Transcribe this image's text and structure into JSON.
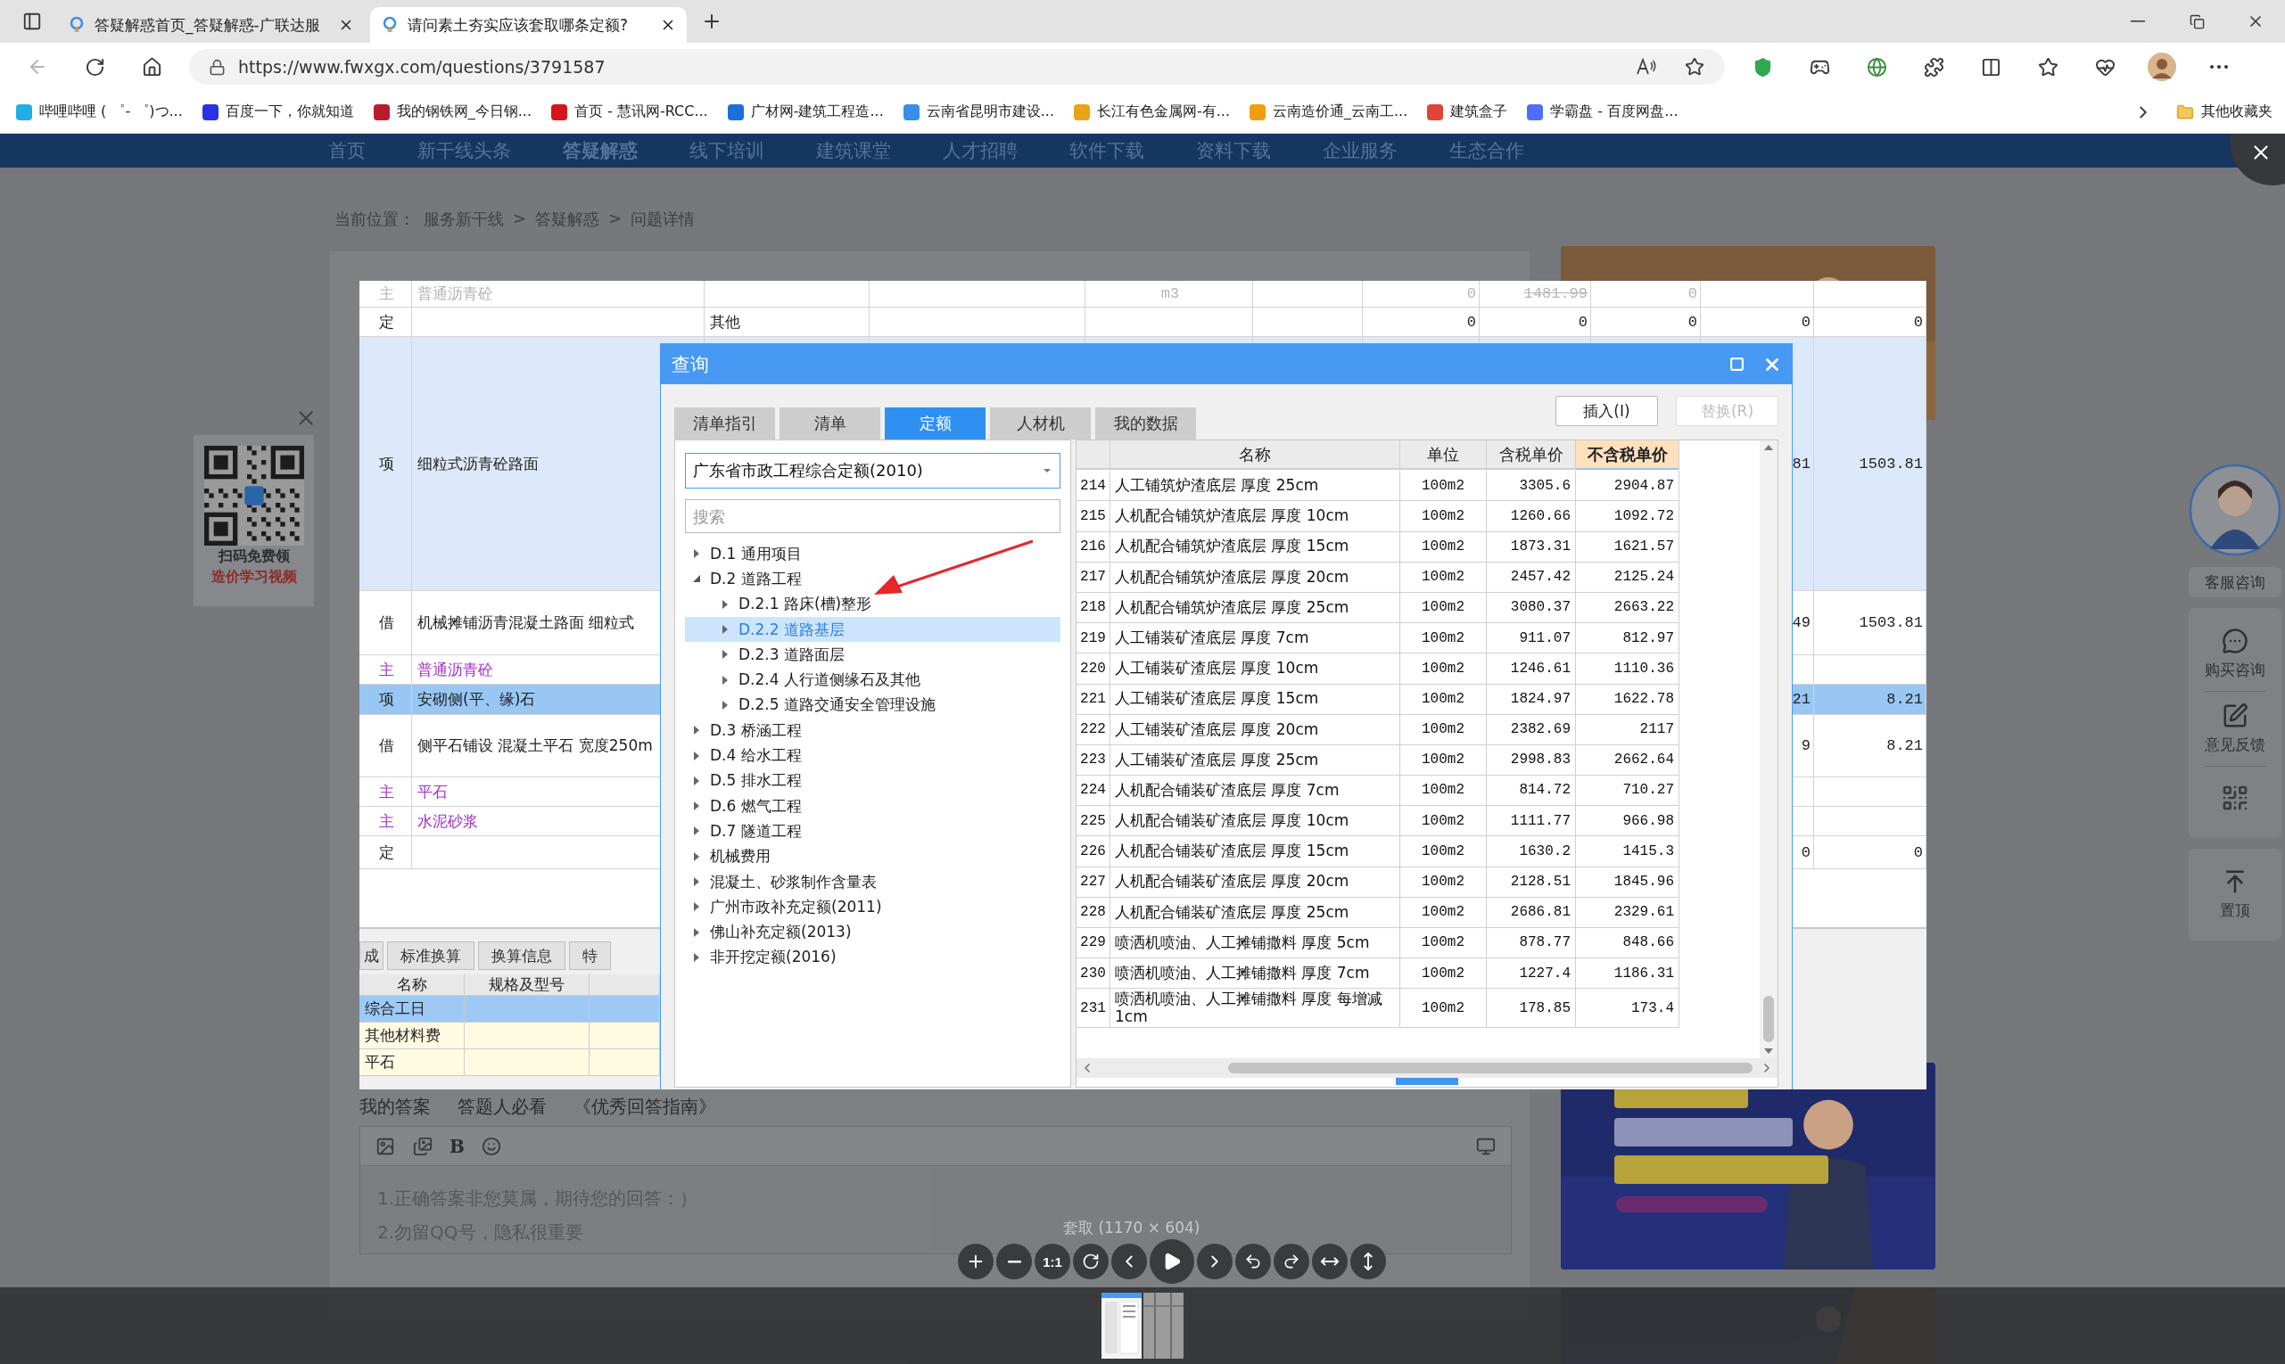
{
  "browser": {
    "tabs": [
      {
        "title": "答疑解惑首页_答疑解惑-广联达服",
        "selected": false
      },
      {
        "title": "请问素土夯实应该套取哪条定额?",
        "selected": true
      }
    ],
    "url": "https://www.fwxgx.com/questions/3791587",
    "bookmarks": [
      {
        "label": "哔哩哔哩 ( ゜- ゜)つ...",
        "color": "#23ade5"
      },
      {
        "label": "百度一下，你就知道",
        "color": "#2932e1"
      },
      {
        "label": "我的钢铁网_今日钢...",
        "color": "#b81c2c"
      },
      {
        "label": "首页 - 慧讯网-RCC...",
        "color": "#d7141a"
      },
      {
        "label": "广材网-建筑工程造...",
        "color": "#1a6fd9"
      },
      {
        "label": "云南省昆明市建设...",
        "color": "#3a8ee6"
      },
      {
        "label": "长江有色金属网-有...",
        "color": "#e8a317"
      },
      {
        "label": "云南造价通_云南工...",
        "color": "#f39c12"
      },
      {
        "label": "建筑盒子",
        "color": "#e0453a"
      },
      {
        "label": "学霸盘 - 百度网盘...",
        "color": "#4f6ef7"
      }
    ],
    "other_favorites": "其他收藏夹"
  },
  "site": {
    "nav": [
      {
        "label": "首页",
        "selected": false
      },
      {
        "label": "新干线头条",
        "selected": false
      },
      {
        "label": "答疑解惑",
        "selected": true
      },
      {
        "label": "线下培训",
        "selected": false
      },
      {
        "label": "建筑课堂",
        "selected": false
      },
      {
        "label": "人才招聘",
        "selected": false
      },
      {
        "label": "软件下载",
        "selected": false
      },
      {
        "label": "资料下载",
        "selected": false
      },
      {
        "label": "企业服务",
        "selected": false
      },
      {
        "label": "生态合作",
        "selected": false
      }
    ],
    "breadcrumb": {
      "label": "当前位置：",
      "separator": ">",
      "links": [
        "服务新干线",
        "答疑解惑",
        "问题详情"
      ]
    },
    "answer_bar": {
      "title": "我的答案",
      "hint": "答题人必看",
      "guide_link": "《优秀回答指南》"
    },
    "editor": {
      "bold_button": "B",
      "placeholder": "1.正确答案非您莫属，期待您的回答：）\n2.勿留QQ号，隐私很重要"
    },
    "qr_promo": {
      "line_1": "扫码免费领",
      "line_2": "造价学习视频"
    },
    "service_sidebar": {
      "avatar_label": "客服咨询",
      "items": [
        "购买咨询",
        "意见反馈"
      ],
      "top_button": "置顶"
    }
  },
  "viewer": {
    "caption": "套取 (1170 × 604)",
    "actual_size_button": "1:1"
  },
  "sheet": {
    "rows": [
      {
        "type": "主",
        "name": "普通沥青砼",
        "kind": "main",
        "selected": false,
        "faded": true,
        "cells": {
          "column_5": "m3",
          "column_7": "0",
          "column_8": "1481.99",
          "column_9": "0"
        }
      },
      {
        "type": "定",
        "kind": "quota",
        "selected": false,
        "faded": false,
        "cells": {
          "column_3": "其他",
          "column_7": "0",
          "column_8": "0",
          "column_9": "0",
          "column_10": "0",
          "column_11": "0"
        }
      },
      {
        "type": "项",
        "name": "细粒式沥青砼路面",
        "kind": "item",
        "selected": false,
        "faded": false,
        "cells": {
          "column_10": "81",
          "column_11": "1503.81"
        }
      },
      {
        "type": "借",
        "name": "机械摊铺沥青混凝土路面 细粒式",
        "kind": "borrowed",
        "selected": false,
        "faded": false,
        "cells": {
          "column_10": "49",
          "column_11": "1503.81"
        }
      },
      {
        "type": "主",
        "name": "普通沥青砼",
        "kind": "main",
        "selected": false,
        "faded": false
      },
      {
        "type": "项",
        "name": "安砌侧(平、缘)石",
        "kind": "item",
        "selected": true,
        "faded": false,
        "cells": {
          "column_10": "21",
          "column_11": "8.21"
        }
      },
      {
        "type": "借",
        "name": "侧平石铺设 混凝土平石 宽度250m",
        "kind": "borrowed",
        "selected": false,
        "faded": false,
        "cells": {
          "column_10": "9",
          "column_11": "8.21"
        }
      },
      {
        "type": "主",
        "name": "平石",
        "kind": "main",
        "selected": false,
        "faded": false
      },
      {
        "type": "主",
        "name": "水泥砂浆",
        "kind": "main",
        "selected": false,
        "faded": false
      },
      {
        "type": "定",
        "kind": "quota",
        "selected": false,
        "faded": false,
        "cells": {
          "column_10": "0",
          "column_11": "0"
        }
      }
    ],
    "bottom_tabs": [
      "成",
      "标准换算",
      "换算信息",
      "特"
    ],
    "detail_table": {
      "columns": [
        "名称",
        "规格及型号"
      ],
      "rows": [
        {
          "name": "综合工日",
          "selected": true
        },
        {
          "name": "其他材料费",
          "selected": false
        },
        {
          "name": "平石",
          "selected": false
        }
      ]
    }
  },
  "dialog": {
    "title": "查询",
    "tabs": [
      {
        "label": "清单指引",
        "selected": false
      },
      {
        "label": "清单",
        "selected": false
      },
      {
        "label": "定额",
        "selected": true
      },
      {
        "label": "人材机",
        "selected": false
      },
      {
        "label": "我的数据",
        "selected": false
      }
    ],
    "buttons": [
      {
        "label": "插入(I)",
        "disabled": false
      },
      {
        "label": "替换(R)",
        "disabled": true
      }
    ],
    "library": "广东省市政工程综合定额(2010)",
    "search_placeholder": "搜索",
    "tree": [
      {
        "label": "D.1 通用项目",
        "expanded": false,
        "selected": false
      },
      {
        "label": "D.2 道路工程",
        "expanded": true,
        "selected": false,
        "children": [
          {
            "label": "D.2.1 路床(槽)整形",
            "expanded": false,
            "selected": false
          },
          {
            "label": "D.2.2 道路基层",
            "expanded": false,
            "selected": true
          },
          {
            "label": "D.2.3 道路面层",
            "expanded": false,
            "selected": false
          },
          {
            "label": "D.2.4 人行道侧缘石及其他",
            "expanded": false,
            "selected": false
          },
          {
            "label": "D.2.5 道路交通安全管理设施",
            "expanded": false,
            "selected": false
          }
        ]
      },
      {
        "label": "D.3 桥涵工程",
        "expanded": false,
        "selected": false
      },
      {
        "label": "D.4 给水工程",
        "expanded": false,
        "selected": false
      },
      {
        "label": "D.5 排水工程",
        "expanded": false,
        "selected": false
      },
      {
        "label": "D.6 燃气工程",
        "expanded": false,
        "selected": false
      },
      {
        "label": "D.7 隧道工程",
        "expanded": false,
        "selected": false
      },
      {
        "label": "机械费用",
        "expanded": false,
        "selected": false
      },
      {
        "label": "混凝土、砂浆制作含量表",
        "expanded": false,
        "selected": false
      },
      {
        "label": "广州市政补充定额(2011)",
        "expanded": false,
        "selected": false
      },
      {
        "label": "佛山补充定额(2013)",
        "expanded": false,
        "selected": false
      },
      {
        "label": "非开挖定额(2016)",
        "expanded": false,
        "selected": false
      }
    ],
    "table": {
      "columns": [
        {
          "label": "名称",
          "selected": false
        },
        {
          "label": "单位",
          "selected": false
        },
        {
          "label": "含税单价",
          "selected": false
        },
        {
          "label": "不含税单价",
          "selected": true
        }
      ],
      "rows": [
        {
          "no": "214",
          "name": "人工铺筑炉渣底层 厚度 25cm",
          "unit": "100m2",
          "price_tax": "3305.6",
          "price": "2904.87"
        },
        {
          "no": "215",
          "name": "人机配合铺筑炉渣底层 厚度 10cm",
          "unit": "100m2",
          "price_tax": "1260.66",
          "price": "1092.72"
        },
        {
          "no": "216",
          "name": "人机配合铺筑炉渣底层 厚度 15cm",
          "unit": "100m2",
          "price_tax": "1873.31",
          "price": "1621.57"
        },
        {
          "no": "217",
          "name": "人机配合铺筑炉渣底层 厚度 20cm",
          "unit": "100m2",
          "price_tax": "2457.42",
          "price": "2125.24"
        },
        {
          "no": "218",
          "name": "人机配合铺筑炉渣底层 厚度 25cm",
          "unit": "100m2",
          "price_tax": "3080.37",
          "price": "2663.22"
        },
        {
          "no": "219",
          "name": "人工铺装矿渣底层 厚度 7cm",
          "unit": "100m2",
          "price_tax": "911.07",
          "price": "812.97"
        },
        {
          "no": "220",
          "name": "人工铺装矿渣底层 厚度 10cm",
          "unit": "100m2",
          "price_tax": "1246.61",
          "price": "1110.36"
        },
        {
          "no": "221",
          "name": "人工铺装矿渣底层 厚度 15cm",
          "unit": "100m2",
          "price_tax": "1824.97",
          "price": "1622.78"
        },
        {
          "no": "222",
          "name": "人工铺装矿渣底层 厚度 20cm",
          "unit": "100m2",
          "price_tax": "2382.69",
          "price": "2117"
        },
        {
          "no": "223",
          "name": "人工铺装矿渣底层 厚度 25cm",
          "unit": "100m2",
          "price_tax": "2998.83",
          "price": "2662.64"
        },
        {
          "no": "224",
          "name": "人机配合铺装矿渣底层 厚度 7cm",
          "unit": "100m2",
          "price_tax": "814.72",
          "price": "710.27"
        },
        {
          "no": "225",
          "name": "人机配合铺装矿渣底层 厚度 10cm",
          "unit": "100m2",
          "price_tax": "1111.77",
          "price": "966.98"
        },
        {
          "no": "226",
          "name": "人机配合铺装矿渣底层 厚度 15cm",
          "unit": "100m2",
          "price_tax": "1630.2",
          "price": "1415.3"
        },
        {
          "no": "227",
          "name": "人机配合铺装矿渣底层 厚度 20cm",
          "unit": "100m2",
          "price_tax": "2128.51",
          "price": "1845.96"
        },
        {
          "no": "228",
          "name": "人机配合铺装矿渣底层 厚度 25cm",
          "unit": "100m2",
          "price_tax": "2686.81",
          "price": "2329.61"
        },
        {
          "no": "229",
          "name": "喷洒机喷油、人工摊铺撒料 厚度 5cm",
          "unit": "100m2",
          "price_tax": "878.77",
          "price": "848.66"
        },
        {
          "no": "230",
          "name": "喷洒机喷油、人工摊铺撒料 厚度 7cm",
          "unit": "100m2",
          "price_tax": "1227.4",
          "price": "1186.31"
        },
        {
          "no": "231",
          "name": "喷洒机喷油、人工摊铺撒料 厚度 每增减1cm",
          "unit": "100m2",
          "price_tax": "178.85",
          "price": "173.4"
        }
      ]
    }
  }
}
